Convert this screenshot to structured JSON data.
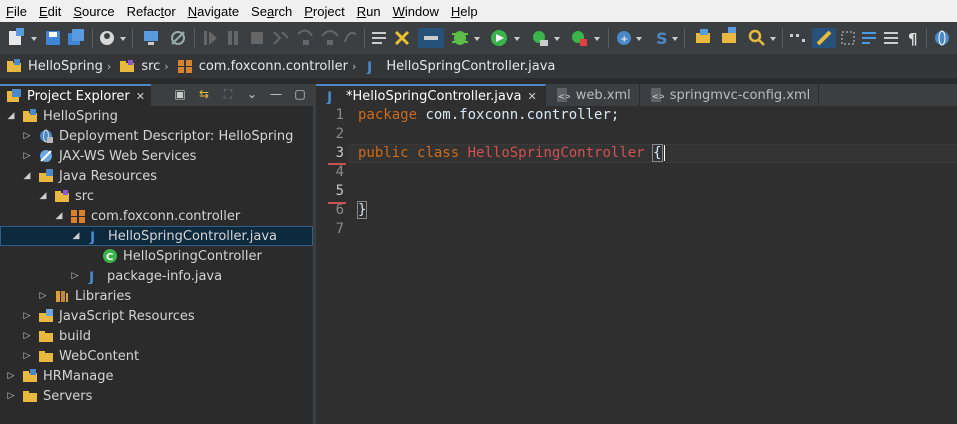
{
  "menubar": {
    "items": [
      {
        "label": "File",
        "u": "F",
        "rest": "ile"
      },
      {
        "label": "Edit",
        "u": "E",
        "rest": "dit"
      },
      {
        "label": "Source",
        "u": "S",
        "rest": "ource"
      },
      {
        "label": "Refactor",
        "pre": "Refac",
        "u": "t",
        "rest": "or"
      },
      {
        "label": "Navigate",
        "u": "N",
        "rest": "avigate"
      },
      {
        "label": "Search",
        "pre": "Se",
        "u": "a",
        "rest": "rch"
      },
      {
        "label": "Project",
        "u": "P",
        "rest": "roject"
      },
      {
        "label": "Run",
        "u": "R",
        "rest": "un"
      },
      {
        "label": "Window",
        "u": "W",
        "rest": "indow"
      },
      {
        "label": "Help",
        "u": "H",
        "rest": "elp"
      }
    ]
  },
  "breadcrumb": {
    "items": [
      {
        "label": "HelloSpring",
        "icon": "project-icon"
      },
      {
        "label": "src",
        "icon": "source-folder-icon"
      },
      {
        "label": "com.foxconn.controller",
        "icon": "package-icon"
      },
      {
        "label": "HelloSpringController.java",
        "icon": "java-file-icon"
      }
    ]
  },
  "explorer": {
    "tab_label": "Project Explorer",
    "close_glyph": "✕"
  },
  "tree": [
    {
      "label": "HelloSpring",
      "depth": 0,
      "twisty": "open",
      "icon": "project-icon"
    },
    {
      "label": "Deployment Descriptor: HelloSpring",
      "depth": 1,
      "twisty": "closed",
      "icon": "deployment-descriptor-icon"
    },
    {
      "label": "JAX-WS Web Services",
      "depth": 1,
      "twisty": "closed",
      "icon": "web-services-icon"
    },
    {
      "label": "Java Resources",
      "depth": 1,
      "twisty": "open",
      "icon": "java-resources-icon"
    },
    {
      "label": "src",
      "depth": 2,
      "twisty": "open",
      "icon": "source-folder-icon"
    },
    {
      "label": "com.foxconn.controller",
      "depth": 3,
      "twisty": "open",
      "icon": "package-icon"
    },
    {
      "label": "HelloSpringController.java",
      "depth": 4,
      "twisty": "open",
      "icon": "java-file-icon",
      "selected": true
    },
    {
      "label": "HelloSpringController",
      "depth": 5,
      "twisty": "none",
      "icon": "class-icon"
    },
    {
      "label": "package-info.java",
      "depth": 4,
      "twisty": "closed",
      "icon": "java-file-icon"
    },
    {
      "label": "Libraries",
      "depth": 2,
      "twisty": "closed",
      "icon": "libraries-icon"
    },
    {
      "label": "JavaScript Resources",
      "depth": 1,
      "twisty": "closed",
      "icon": "javascript-resources-icon"
    },
    {
      "label": "build",
      "depth": 1,
      "twisty": "closed",
      "icon": "folder-icon"
    },
    {
      "label": "WebContent",
      "depth": 1,
      "twisty": "closed",
      "icon": "folder-icon"
    },
    {
      "label": "HRManage",
      "depth": 0,
      "twisty": "closed",
      "icon": "project-icon"
    },
    {
      "label": "Servers",
      "depth": 0,
      "twisty": "closed",
      "icon": "folder-icon"
    }
  ],
  "editor": {
    "tabs": [
      {
        "label": "*HelloSpringController.java",
        "active": true,
        "icon": "java-file-icon",
        "closable": true
      },
      {
        "label": "web.xml",
        "active": false,
        "icon": "xml-file-icon",
        "closable": false
      },
      {
        "label": "springmvc-config.xml",
        "active": false,
        "icon": "xml-file-icon",
        "closable": false
      }
    ],
    "line_numbers": [
      "1",
      "2",
      "3",
      "4",
      "5",
      "6",
      "7"
    ],
    "code": {
      "line1_kw": "package",
      "line1_rest": " com.foxconn.controller;",
      "line3_kw1": "public",
      "line3_kw2": "class",
      "line3_cls": "HelloSpringController",
      "line3_brace": "{",
      "line6_brace": "}"
    }
  },
  "colors": {
    "keyword": "#cc6c1d",
    "classname": "#d25252",
    "accent": "#4a88c7"
  }
}
